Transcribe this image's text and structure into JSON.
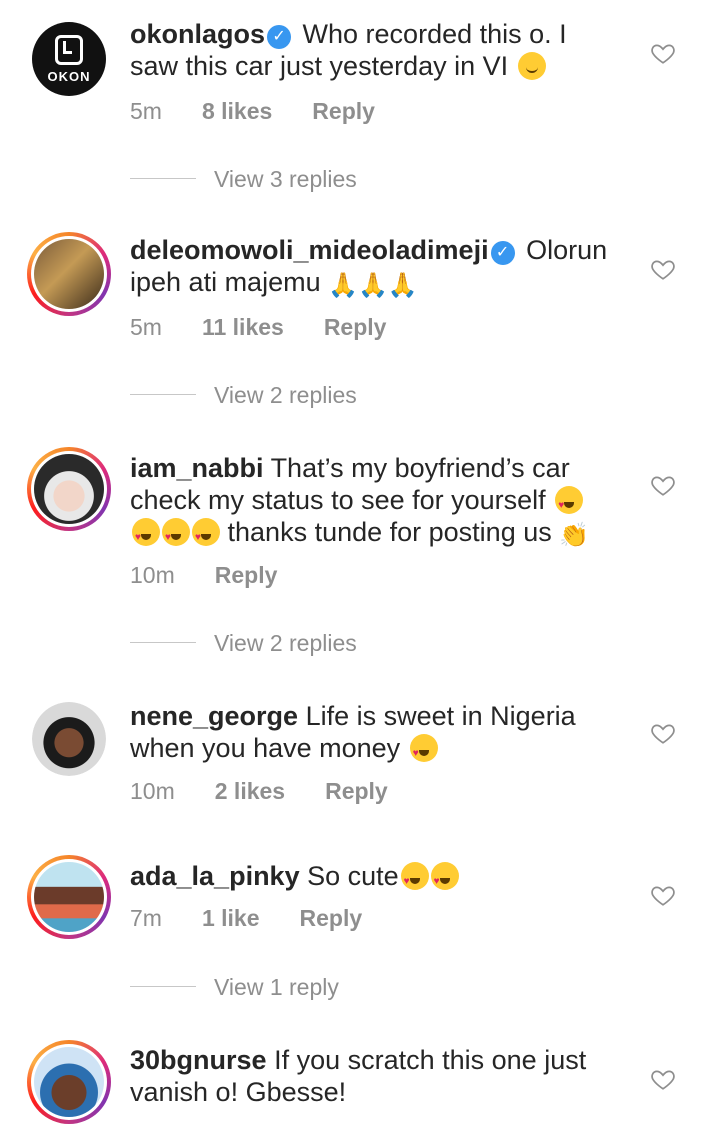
{
  "comments": [
    {
      "username": "okonlagos",
      "verified": true,
      "text": "Who recorded this o. I",
      "text2": "saw this car just yesterday in VI",
      "time": "5m",
      "likes": "8 likes",
      "reply": "Reply",
      "view_replies": "View 3 replies",
      "avatar_brand": "OKON"
    },
    {
      "username": "deleomowoli_mideoladimeji",
      "verified": true,
      "text": "Olorun",
      "text2": "ipeh ati majemu",
      "time": "5m",
      "likes": "11 likes",
      "reply": "Reply",
      "view_replies": "View 2 replies"
    },
    {
      "username": "iam_nabbi",
      "text": "That’s my boyfriend’s car",
      "text2": "check my status to see for yourself",
      "text3": "thanks tunde for posting us",
      "time": "10m",
      "reply": "Reply",
      "view_replies": "View 2 replies"
    },
    {
      "username": "nene_george",
      "text": "Life is sweet in Nigeria",
      "text2": "when you have money",
      "time": "10m",
      "likes": "2 likes",
      "reply": "Reply"
    },
    {
      "username": "ada_la_pinky",
      "text": "So cute",
      "time": "7m",
      "likes": "1 like",
      "reply": "Reply",
      "view_replies": "View 1 reply"
    },
    {
      "username": "30bgnurse",
      "text": "If you scratch this one just",
      "text2": "vanish o! Gbesse!"
    }
  ],
  "icons": {
    "heart": "heart-outline-icon",
    "verified": "verified-badge-icon"
  }
}
